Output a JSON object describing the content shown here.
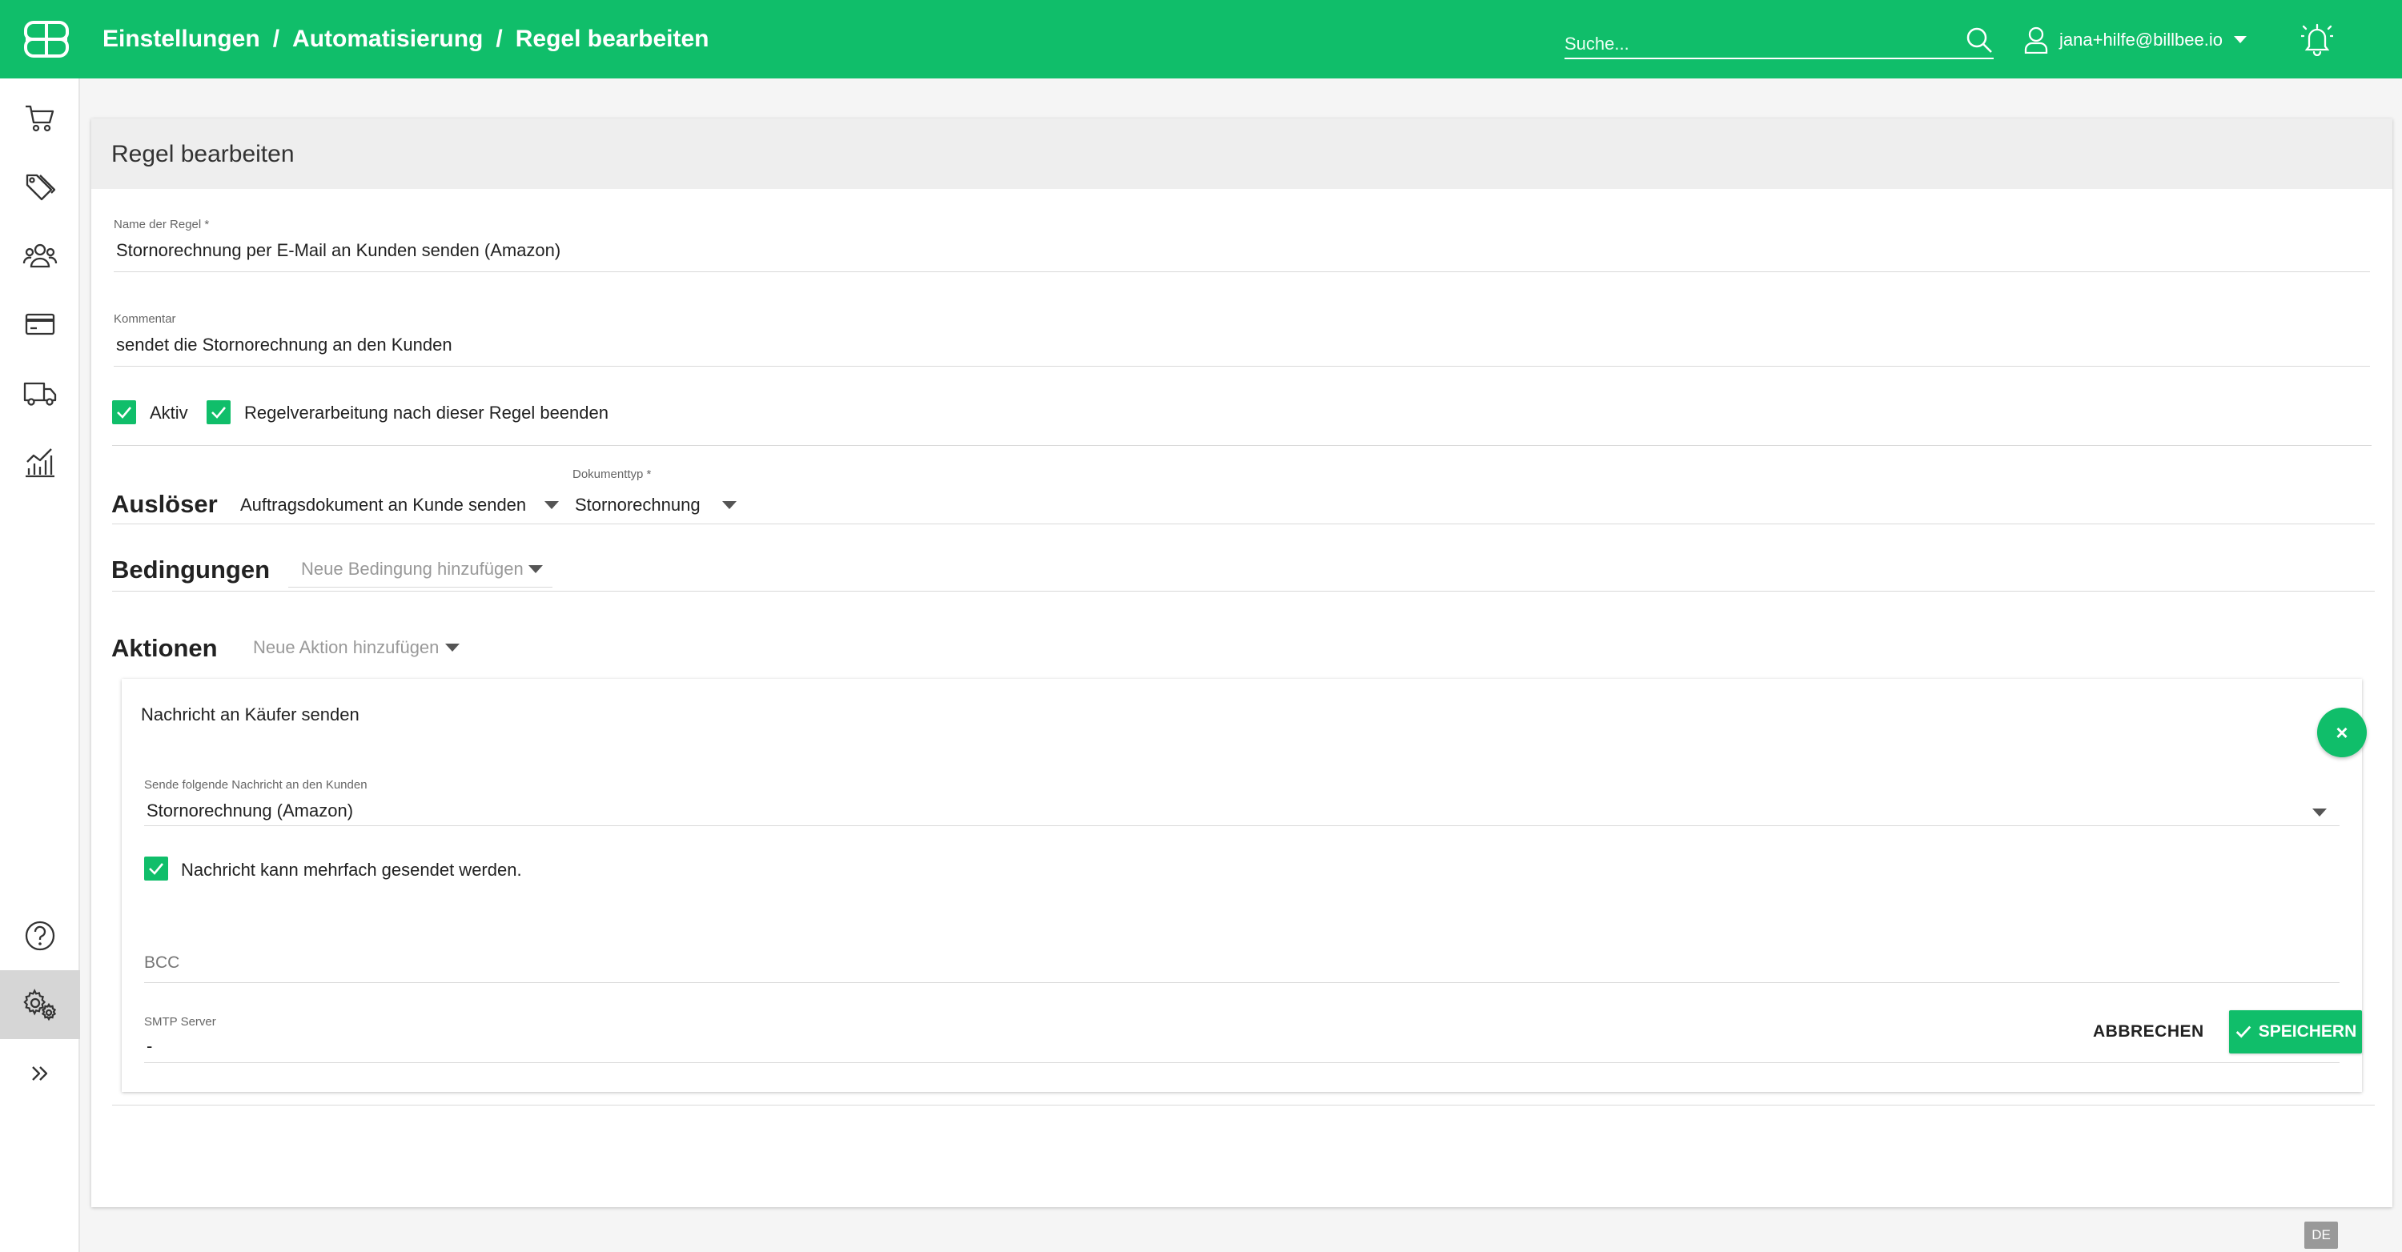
{
  "header": {
    "breadcrumb": [
      "Einstellungen",
      "Automatisierung",
      "Regel bearbeiten"
    ],
    "separator": "/",
    "search_placeholder": "Suche...",
    "user_email": "jana+hilfe@billbee.io",
    "accent_color": "#10be6a"
  },
  "sidebar": {
    "items": [
      {
        "icon": "cart-icon"
      },
      {
        "icon": "tags-icon"
      },
      {
        "icon": "customers-icon"
      },
      {
        "icon": "payment-card-icon"
      },
      {
        "icon": "truck-icon"
      },
      {
        "icon": "analytics-icon"
      }
    ],
    "bottom_items": [
      {
        "icon": "help-icon"
      },
      {
        "icon": "settings-gears-icon",
        "active": true
      },
      {
        "icon": "expand-chevrons-icon"
      }
    ]
  },
  "card": {
    "title": "Regel bearbeiten",
    "rule_name_label": "Name der Regel *",
    "rule_name_value": "Stornorechnung per E-Mail an Kunden senden (Amazon)",
    "comment_label": "Kommentar",
    "comment_value": "sendet die Stornorechnung an den Kunden",
    "active_label": "Aktiv",
    "active_checked": true,
    "stop_label": "Regelverarbeitung nach dieser Regel beenden",
    "stop_checked": true,
    "trigger_title": "Auslöser",
    "trigger_value": "Auftragsdokument an Kunde senden",
    "doctype_label": "Dokumenttyp *",
    "doctype_value": "Stornorechnung",
    "conditions_title": "Bedingungen",
    "conditions_placeholder": "Neue Bedingung hinzufügen",
    "actions_title": "Aktionen",
    "actions_placeholder": "Neue Aktion hinzufügen"
  },
  "action": {
    "title": "Nachricht an Käufer senden",
    "close_symbol": "×",
    "message_label": "Sende folgende Nachricht an den Kunden",
    "message_value": "Stornorechnung (Amazon)",
    "multiple_label": "Nachricht kann mehrfach gesendet werden.",
    "multiple_checked": true,
    "bcc_placeholder": "BCC",
    "smtp_label": "SMTP Server",
    "smtp_value": "-"
  },
  "footer": {
    "cancel_label": "ABBRECHEN",
    "save_label": "SPEICHERN",
    "language": "DE"
  }
}
